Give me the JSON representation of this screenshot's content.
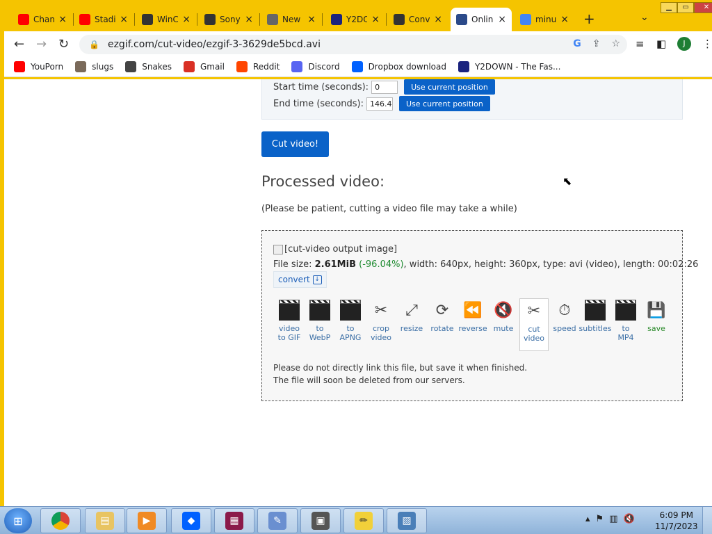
{
  "tabs": [
    {
      "label": "Chan",
      "icon": "youtube-icon",
      "color": "#ff0000"
    },
    {
      "label": "Stadi",
      "icon": "youtube-icon",
      "color": "#ff0000"
    },
    {
      "label": "WinC",
      "icon": "gear-icon",
      "color": "#333333"
    },
    {
      "label": "Sony",
      "icon": "museum-icon",
      "color": "#333333"
    },
    {
      "label": "New",
      "icon": "chrome-icon",
      "color": "#666666"
    },
    {
      "label": "Y2DO",
      "icon": "y2down-icon",
      "color": "#1a237e"
    },
    {
      "label": "Conv",
      "icon": "convert-icon",
      "color": "#333333"
    },
    {
      "label": "Onlin",
      "icon": "ezgif-icon",
      "color": "#2b4a8a",
      "active": true
    },
    {
      "label": "minu",
      "icon": "google-icon",
      "color": "#4285f4"
    }
  ],
  "newtab": "+",
  "url": "ezgif.com/cut-video/ezgif-3-3629de5bcd.avi",
  "avatar": "J",
  "bookmarks": [
    {
      "label": "YouPorn",
      "color": "#ff0000"
    },
    {
      "label": "slugs",
      "color": "#7a6a5a"
    },
    {
      "label": "Snakes",
      "color": "#444444"
    },
    {
      "label": "Gmail",
      "color": "#d93025"
    },
    {
      "label": "Reddit",
      "color": "#ff4500"
    },
    {
      "label": "Discord",
      "color": "#5865f2"
    },
    {
      "label": "Dropbox download",
      "color": "#0061ff"
    },
    {
      "label": "Y2DOWN - The Fas...",
      "color": "#1a237e"
    }
  ],
  "settings": {
    "start_label": "Start time (seconds):",
    "start_value": "0",
    "end_label": "End time (seconds):",
    "end_value": "146.4",
    "use_current": "Use current position"
  },
  "cut_button": "Cut video!",
  "processed_title": "Processed video:",
  "patience_note": "(Please be patient, cutting a video file may take a while)",
  "output": {
    "img_alt": "[cut-video output image]",
    "size_prefix": "File size: ",
    "size": "2.61MiB",
    "pct": "(-96.04%)",
    "details": ", width: 640px, height: 360px, type: avi (video), length: 00:02:26",
    "convert": "convert"
  },
  "tools": [
    {
      "l1": "video",
      "l2": "to GIF",
      "icon": "clapper-icon"
    },
    {
      "l1": "to",
      "l2": "WebP",
      "icon": "clapper-icon"
    },
    {
      "l1": "to",
      "l2": "APNG",
      "icon": "clapper-icon"
    },
    {
      "l1": "crop",
      "l2": "video",
      "icon": "crop-icon"
    },
    {
      "l1": "resize",
      "l2": "",
      "icon": "resize-icon"
    },
    {
      "l1": "rotate",
      "l2": "",
      "icon": "rotate-icon"
    },
    {
      "l1": "reverse",
      "l2": "",
      "icon": "reverse-icon"
    },
    {
      "l1": "mute",
      "l2": "",
      "icon": "mute-icon"
    },
    {
      "l1": "cut",
      "l2": "video",
      "icon": "scissors-icon",
      "active": true
    },
    {
      "l1": "speed",
      "l2": "",
      "icon": "speed-icon"
    },
    {
      "l1": "subtitles",
      "l2": "",
      "icon": "subtitles-icon"
    },
    {
      "l1": "to",
      "l2": "MP4",
      "icon": "mp4-icon"
    },
    {
      "l1": "save",
      "l2": "",
      "icon": "save-icon"
    }
  ],
  "warning": {
    "line1": "Please do not directly link this file, but save it when finished.",
    "line2": "The file will soon be deleted from our servers."
  },
  "clock": {
    "time": "6:09 PM",
    "date": "11/7/2023"
  }
}
